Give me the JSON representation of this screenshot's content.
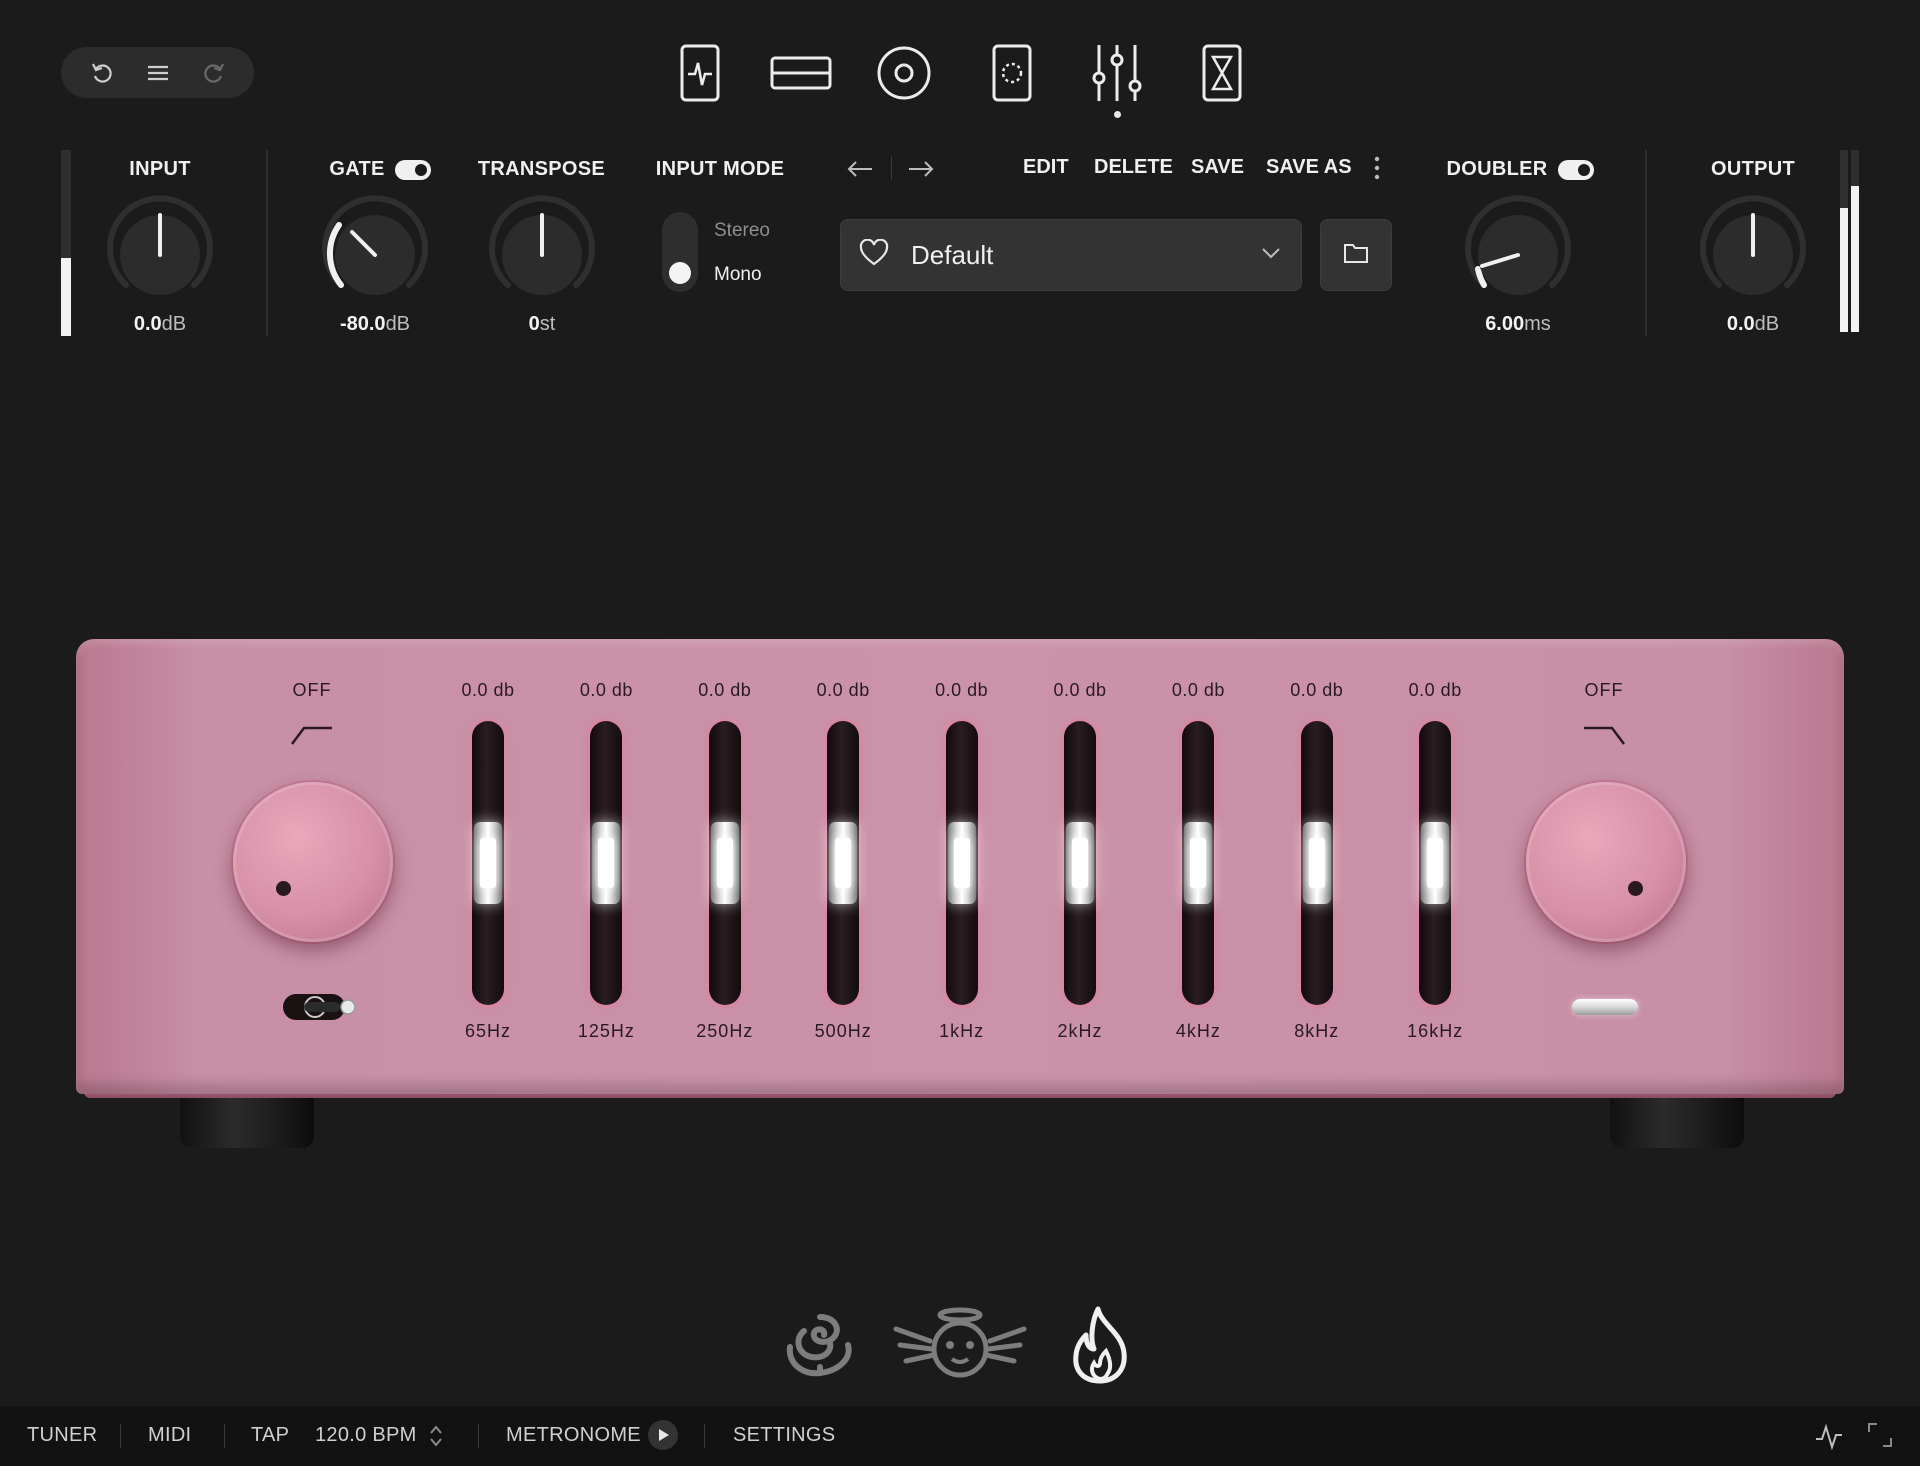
{
  "toolbar": {
    "history_icons": [
      "undo-icon",
      "menu-icon",
      "redo-icon"
    ],
    "nav_icons": [
      "pedal-icon",
      "amp-icon",
      "speaker-icon",
      "cabinet-icon",
      "mixer-icon",
      "timer-icon"
    ],
    "active_nav": "mixer-icon"
  },
  "controls": {
    "input": {
      "label": "INPUT",
      "value": "0.0",
      "unit": "dB",
      "meter_level": 0.42
    },
    "gate": {
      "label": "GATE",
      "value": "-80.0",
      "unit": "dB",
      "enabled": true
    },
    "transpose": {
      "label": "TRANSPOSE",
      "value": "0",
      "unit": "st"
    },
    "input_mode": {
      "label": "INPUT MODE",
      "options": [
        "Stereo",
        "Mono"
      ],
      "selected": "Mono"
    },
    "doubler": {
      "label": "DOUBLER",
      "value": "6.00",
      "unit": "ms",
      "enabled": true
    },
    "output": {
      "label": "OUTPUT",
      "value": "0.0",
      "unit": "dB",
      "meter_level": 0.8
    }
  },
  "preset": {
    "actions": [
      "EDIT",
      "DELETE",
      "SAVE",
      "SAVE AS"
    ],
    "name": "Default",
    "prev_icon": "arrow-left-icon",
    "next_icon": "arrow-right-icon",
    "more_icon": "more-vertical-icon"
  },
  "eq": {
    "low_cut": {
      "state": "OFF"
    },
    "high_cut": {
      "state": "OFF"
    },
    "bands": [
      {
        "gain": "0.0 db",
        "freq": "65Hz"
      },
      {
        "gain": "0.0 db",
        "freq": "125Hz"
      },
      {
        "gain": "0.0 db",
        "freq": "250Hz"
      },
      {
        "gain": "0.0 db",
        "freq": "500Hz"
      },
      {
        "gain": "0.0 db",
        "freq": "1kHz"
      },
      {
        "gain": "0.0 db",
        "freq": "2kHz"
      },
      {
        "gain": "0.0 db",
        "freq": "4kHz"
      },
      {
        "gain": "0.0 db",
        "freq": "8kHz"
      },
      {
        "gain": "0.0 db",
        "freq": "16kHz"
      }
    ],
    "colors": {
      "chassis": "#cb93aa",
      "knob": "#d690a7"
    }
  },
  "amp_selector": {
    "icons": [
      "rose-icon",
      "angel-icon",
      "flame-icon"
    ],
    "active": "flame-icon"
  },
  "status_bar": {
    "tuner": "TUNER",
    "midi": "MIDI",
    "tap": "TAP",
    "bpm": "120.0 BPM",
    "metronome": "METRONOME",
    "settings": "SETTINGS"
  }
}
